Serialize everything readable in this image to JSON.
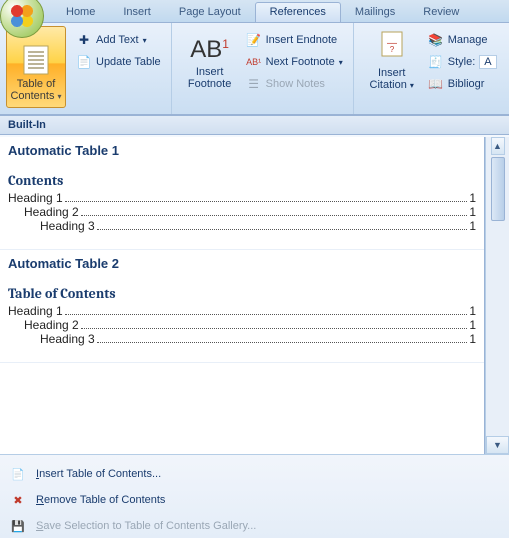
{
  "tabs": {
    "items": [
      "Home",
      "Insert",
      "Page Layout",
      "References",
      "Mailings",
      "Review"
    ],
    "active_index": 3
  },
  "ribbon": {
    "toc": {
      "big_label_1": "Table of",
      "big_label_2": "Contents",
      "add_text": "Add Text",
      "update_table": "Update Table"
    },
    "footnotes": {
      "big_label_1": "Insert",
      "big_label_2": "Footnote",
      "insert_endnote": "Insert Endnote",
      "next_footnote": "Next Footnote",
      "show_notes": "Show Notes"
    },
    "citations": {
      "big_label_1": "Insert",
      "big_label_2": "Citation",
      "manage": "Manage",
      "style_label": "Style:",
      "style_value": "A",
      "bibliography": "Bibliogr"
    }
  },
  "gallery": {
    "section": "Built-In",
    "presets": [
      {
        "title": "Automatic Table 1",
        "heading": "Contents",
        "lines": [
          {
            "name": "Heading 1",
            "page": "1",
            "indent": 0
          },
          {
            "name": "Heading 2",
            "page": "1",
            "indent": 1
          },
          {
            "name": "Heading 3",
            "page": "1",
            "indent": 2
          }
        ]
      },
      {
        "title": "Automatic Table 2",
        "heading": "Table of Contents",
        "lines": [
          {
            "name": "Heading 1",
            "page": "1",
            "indent": 0
          },
          {
            "name": "Heading 2",
            "page": "1",
            "indent": 1
          },
          {
            "name": "Heading 3",
            "page": "1",
            "indent": 2
          }
        ]
      }
    ]
  },
  "footer": {
    "insert": "Insert Table of Contents...",
    "remove": "Remove Table of Contents",
    "save": "Save Selection to Table of Contents Gallery...",
    "insert_u": "I",
    "remove_u": "R",
    "save_u": "S"
  }
}
